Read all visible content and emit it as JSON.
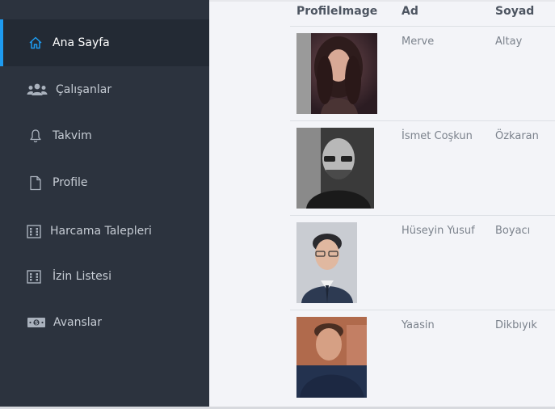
{
  "sidebar": {
    "items": [
      {
        "label": "Ana Sayfa",
        "icon": "home-icon",
        "active": true
      },
      {
        "label": "Çalışanlar",
        "icon": "users-icon"
      },
      {
        "label": "Takvim",
        "icon": "bell-icon"
      },
      {
        "label": "Profile",
        "icon": "document-icon"
      },
      {
        "label": "Harcama Talepleri",
        "icon": "list-box-icon"
      },
      {
        "label": "İzin Listesi",
        "icon": "list-box-icon"
      },
      {
        "label": "Avanslar",
        "icon": "money-icon"
      }
    ],
    "accent_color": "#1e9bf0"
  },
  "table": {
    "headers": [
      "ProfileImage",
      "Ad",
      "Soyad"
    ],
    "rows": [
      {
        "ad": "Merve",
        "soyad": "Altay",
        "photo": "portrait-woman-curly-hair"
      },
      {
        "ad": "İsmet Coşkun",
        "soyad": "Özkaran",
        "photo": "portrait-man-glasses-bw"
      },
      {
        "ad": "Hüseyin Yusuf",
        "soyad": "Boyacı",
        "photo": "portrait-man-suit-glasses"
      },
      {
        "ad": "Yaasin",
        "soyad": "Dikbıyık",
        "photo": "portrait-young-man-blurred"
      }
    ]
  }
}
